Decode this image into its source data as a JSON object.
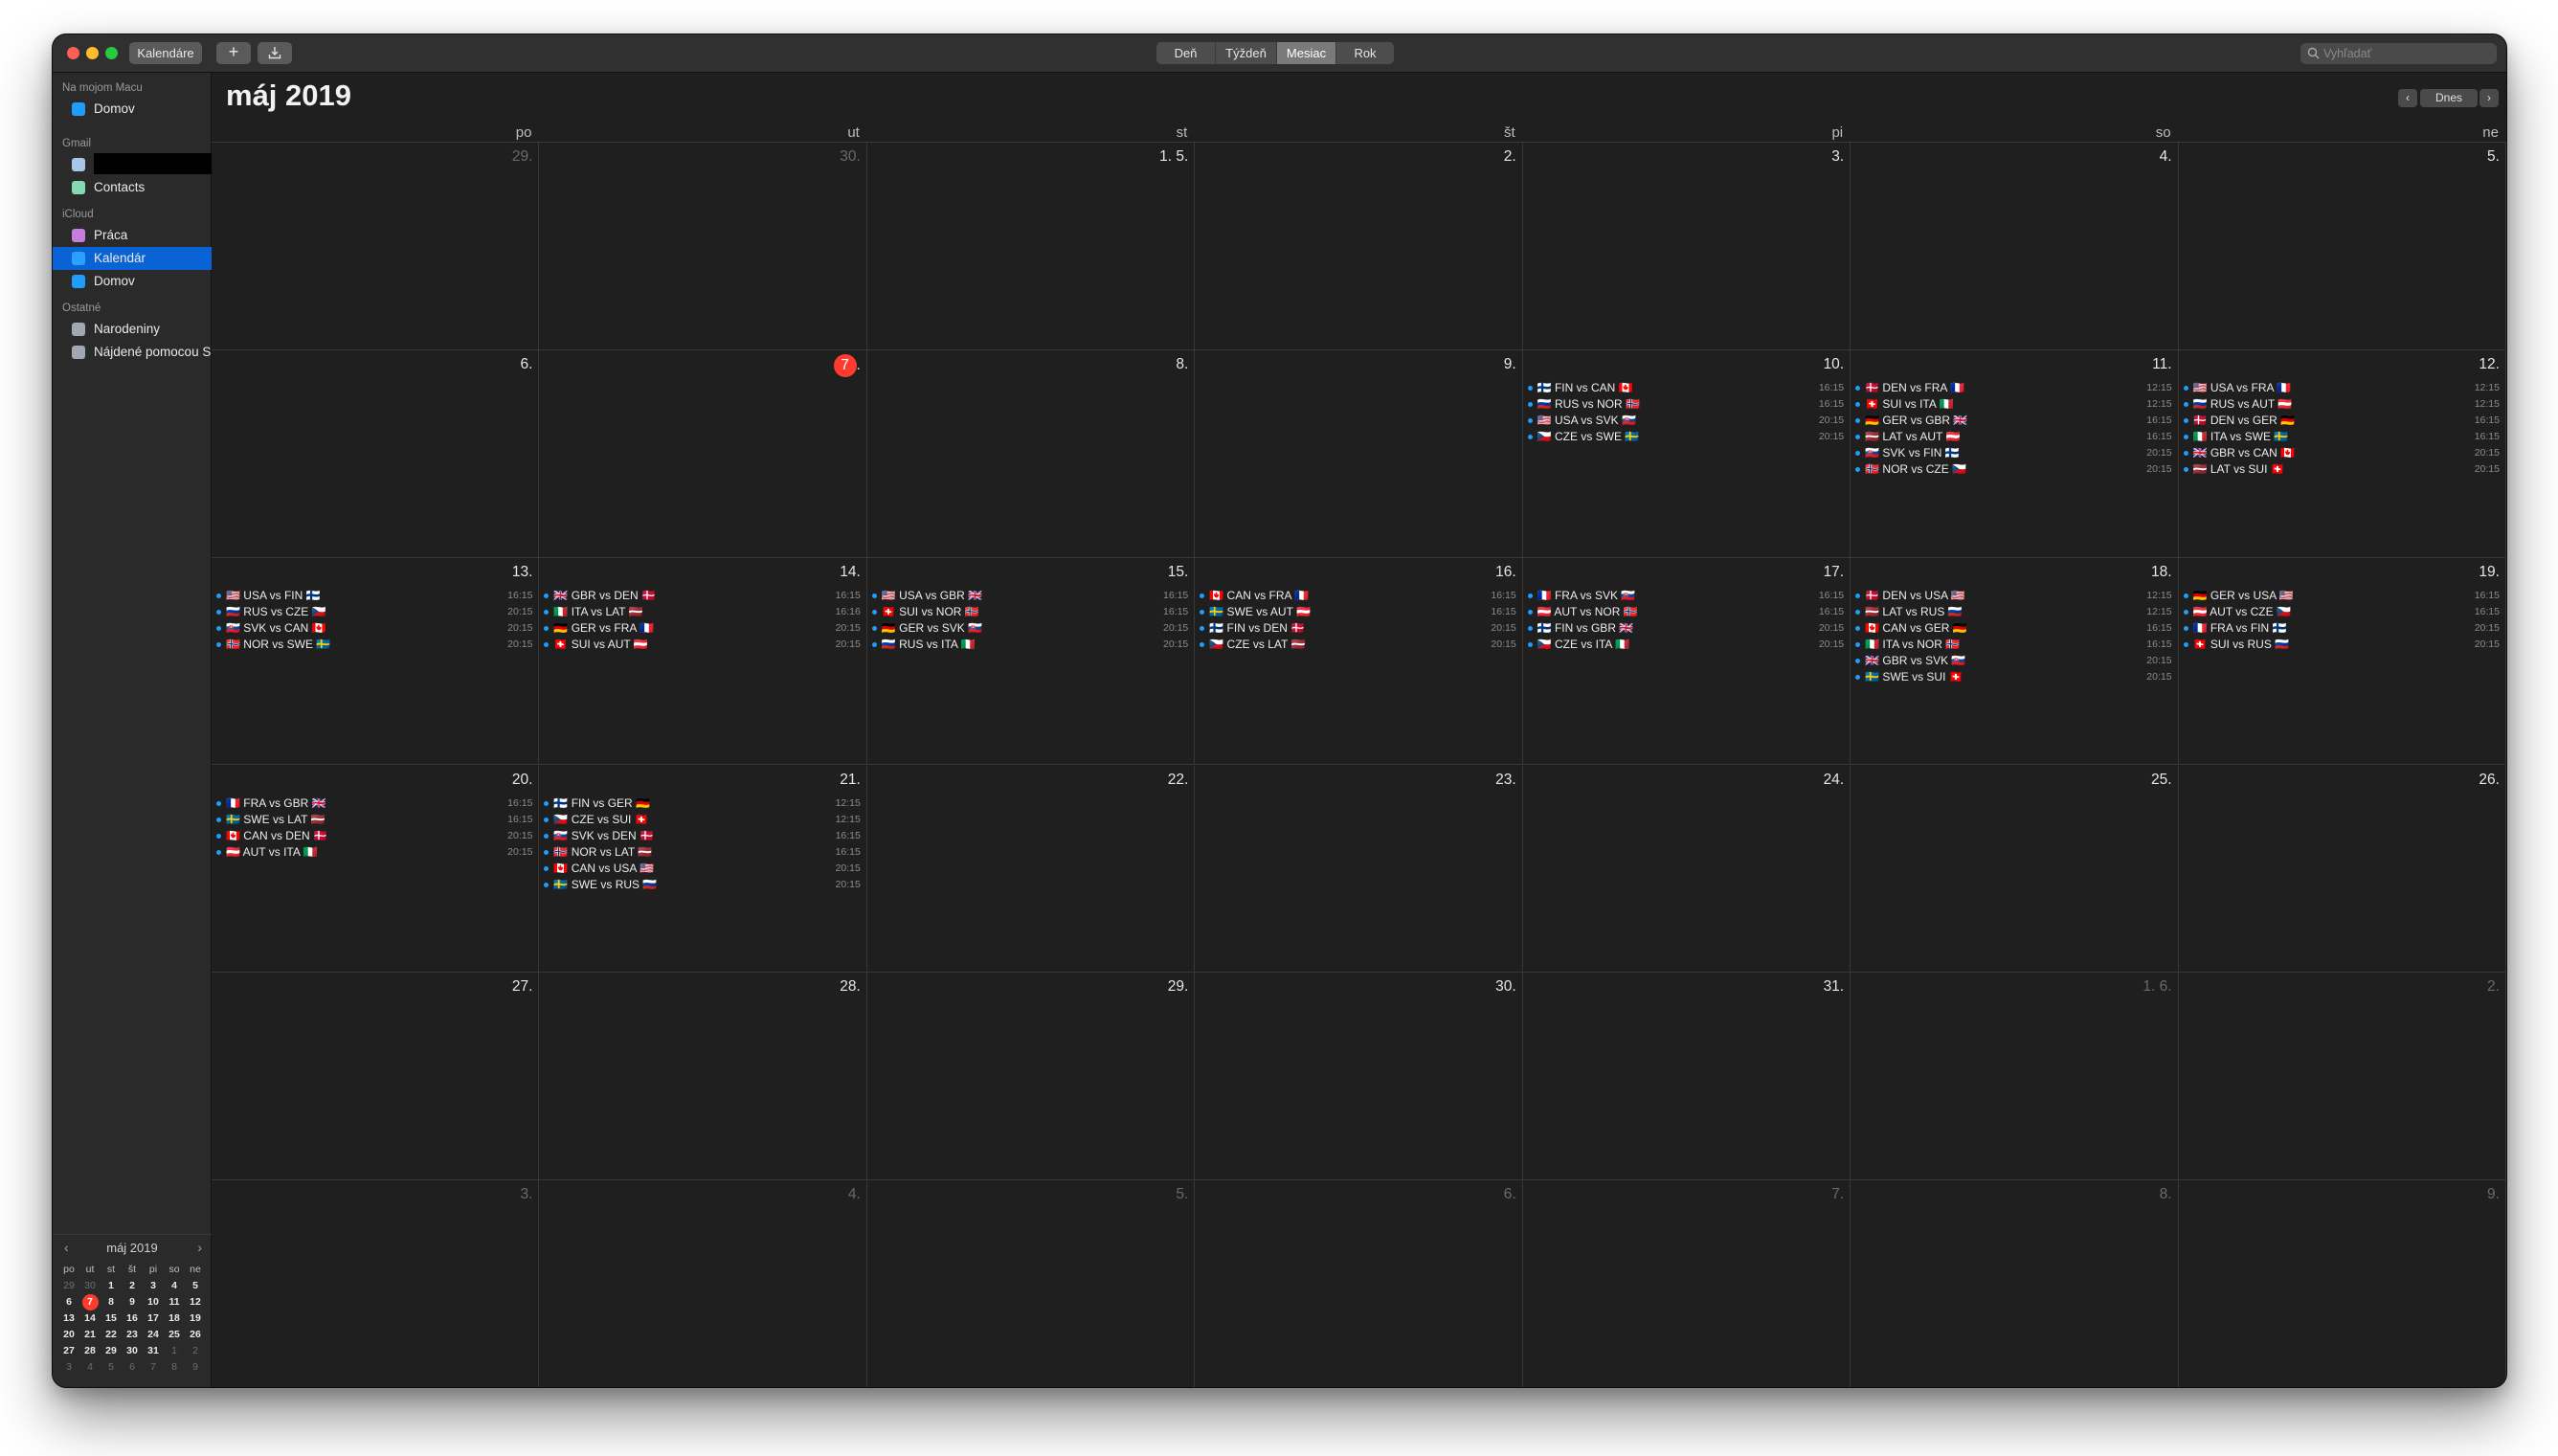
{
  "toolbar": {
    "calendars_label": "Kalendáre",
    "add_label": "+",
    "views": [
      "Deň",
      "Týždeň",
      "Mesiac",
      "Rok"
    ],
    "active_view": "Mesiac",
    "search_placeholder": "Vyhľadať"
  },
  "sidebar": {
    "groups": [
      {
        "label": "Na mojom Macu",
        "items": [
          {
            "name": "Domov",
            "color": "#1e9dfc"
          }
        ]
      },
      {
        "label": "Gmail",
        "items": [
          {
            "name": "",
            "color": "#a7c7e7",
            "redacted": true
          },
          {
            "name": "Contacts",
            "color": "#84d9b1"
          }
        ]
      },
      {
        "label": "iCloud",
        "items": [
          {
            "name": "Práca",
            "color": "#c77dde"
          },
          {
            "name": "Kalendár",
            "color": "#2aa1ff",
            "selected": true
          },
          {
            "name": "Domov",
            "color": "#1e9dfc"
          }
        ]
      },
      {
        "label": "Ostatné",
        "items": [
          {
            "name": "Narodeniny",
            "color": "#a2a8b2"
          },
          {
            "name": "Nájdené pomocou Siri",
            "color": "#a2a8b2"
          }
        ]
      }
    ]
  },
  "mini_calendar": {
    "title": "máj 2019",
    "headers": [
      "po",
      "ut",
      "st",
      "št",
      "pi",
      "so",
      "ne"
    ],
    "weeks": [
      [
        "29",
        "30",
        "1",
        "2",
        "3",
        "4",
        "5"
      ],
      [
        "6",
        "7",
        "8",
        "9",
        "10",
        "11",
        "12"
      ],
      [
        "13",
        "14",
        "15",
        "16",
        "17",
        "18",
        "19"
      ],
      [
        "20",
        "21",
        "22",
        "23",
        "24",
        "25",
        "26"
      ],
      [
        "27",
        "28",
        "29",
        "30",
        "31",
        "1",
        "2"
      ],
      [
        "3",
        "4",
        "5",
        "6",
        "7",
        "8",
        "9"
      ]
    ]
  },
  "main": {
    "month_title": "máj 2019",
    "today_label": "Dnes",
    "weekdays": [
      "po",
      "ut",
      "st",
      "št",
      "pi",
      "so",
      "ne"
    ],
    "weeks": [
      [
        {
          "label": "29.",
          "dim": true,
          "events": []
        },
        {
          "label": "30.",
          "dim": true,
          "events": []
        },
        {
          "label": "1. 5.",
          "events": []
        },
        {
          "label": "2.",
          "events": []
        },
        {
          "label": "3.",
          "events": []
        },
        {
          "label": "4.",
          "events": []
        },
        {
          "label": "5.",
          "events": []
        }
      ],
      [
        {
          "label": "6.",
          "events": []
        },
        {
          "label": "7",
          "suffix": ".",
          "today": true,
          "events": []
        },
        {
          "label": "8.",
          "events": []
        },
        {
          "label": "9.",
          "events": []
        },
        {
          "label": "10.",
          "events": [
            {
              "title": "🇫🇮 FIN vs CAN 🇨🇦",
              "time": "16:15"
            },
            {
              "title": "🇷🇺 RUS vs NOR 🇳🇴",
              "time": "16:15"
            },
            {
              "title": "🇺🇸 USA vs SVK 🇸🇰",
              "time": "20:15"
            },
            {
              "title": "🇨🇿 CZE vs SWE 🇸🇪",
              "time": "20:15"
            }
          ]
        },
        {
          "label": "11.",
          "events": [
            {
              "title": "🇩🇰 DEN vs FRA 🇫🇷",
              "time": "12:15"
            },
            {
              "title": "🇨🇭 SUI vs ITA 🇮🇹",
              "time": "12:15"
            },
            {
              "title": "🇩🇪 GER vs GBR 🇬🇧",
              "time": "16:15"
            },
            {
              "title": "🇱🇻 LAT vs AUT 🇦🇹",
              "time": "16:15"
            },
            {
              "title": "🇸🇰 SVK vs FIN 🇫🇮",
              "time": "20:15"
            },
            {
              "title": "🇳🇴 NOR vs CZE 🇨🇿",
              "time": "20:15"
            }
          ]
        },
        {
          "label": "12.",
          "events": [
            {
              "title": "🇺🇸 USA vs FRA 🇫🇷",
              "time": "12:15"
            },
            {
              "title": "🇷🇺 RUS vs AUT 🇦🇹",
              "time": "12:15"
            },
            {
              "title": "🇩🇰 DEN vs GER 🇩🇪",
              "time": "16:15"
            },
            {
              "title": "🇮🇹 ITA vs SWE 🇸🇪",
              "time": "16:15"
            },
            {
              "title": "🇬🇧 GBR vs CAN 🇨🇦",
              "time": "20:15"
            },
            {
              "title": "🇱🇻 LAT vs SUI 🇨🇭",
              "time": "20:15"
            }
          ]
        }
      ],
      [
        {
          "label": "13.",
          "events": [
            {
              "title": "🇺🇸 USA vs FIN 🇫🇮",
              "time": "16:15"
            },
            {
              "title": "🇷🇺 RUS vs CZE 🇨🇿",
              "time": "20:15"
            },
            {
              "title": "🇸🇰 SVK vs CAN 🇨🇦",
              "time": "20:15"
            },
            {
              "title": "🇳🇴 NOR vs SWE 🇸🇪",
              "time": "20:15"
            }
          ]
        },
        {
          "label": "14.",
          "events": [
            {
              "title": "🇬🇧 GBR vs DEN 🇩🇰",
              "time": "16:15"
            },
            {
              "title": "🇮🇹 ITA vs LAT 🇱🇻",
              "time": "16:16"
            },
            {
              "title": "🇩🇪 GER vs FRA 🇫🇷",
              "time": "20:15"
            },
            {
              "title": "🇨🇭 SUI vs AUT 🇦🇹",
              "time": "20:15"
            }
          ]
        },
        {
          "label": "15.",
          "events": [
            {
              "title": "🇺🇸 USA vs GBR 🇬🇧",
              "time": "16:15"
            },
            {
              "title": "🇨🇭 SUI vs NOR 🇳🇴",
              "time": "16:15"
            },
            {
              "title": "🇩🇪 GER vs SVK 🇸🇰",
              "time": "20:15"
            },
            {
              "title": "🇷🇺 RUS vs ITA 🇮🇹",
              "time": "20:15"
            }
          ]
        },
        {
          "label": "16.",
          "events": [
            {
              "title": "🇨🇦 CAN vs FRA 🇫🇷",
              "time": "16:15"
            },
            {
              "title": "🇸🇪 SWE vs AUT 🇦🇹",
              "time": "16:15"
            },
            {
              "title": "🇫🇮 FIN vs DEN 🇩🇰",
              "time": "20:15"
            },
            {
              "title": "🇨🇿 CZE vs LAT 🇱🇻",
              "time": "20:15"
            }
          ]
        },
        {
          "label": "17.",
          "events": [
            {
              "title": "🇫🇷 FRA vs SVK 🇸🇰",
              "time": "16:15"
            },
            {
              "title": "🇦🇹 AUT vs NOR 🇳🇴",
              "time": "16:15"
            },
            {
              "title": "🇫🇮 FIN vs GBR 🇬🇧",
              "time": "20:15"
            },
            {
              "title": "🇨🇿 CZE vs ITA 🇮🇹",
              "time": "20:15"
            }
          ]
        },
        {
          "label": "18.",
          "events": [
            {
              "title": "🇩🇰 DEN vs USA 🇺🇸",
              "time": "12:15"
            },
            {
              "title": "🇱🇻 LAT vs RUS 🇷🇺",
              "time": "12:15"
            },
            {
              "title": "🇨🇦 CAN vs GER 🇩🇪",
              "time": "16:15"
            },
            {
              "title": "🇮🇹 ITA vs NOR 🇳🇴",
              "time": "16:15"
            },
            {
              "title": "🇬🇧 GBR vs SVK 🇸🇰",
              "time": "20:15"
            },
            {
              "title": "🇸🇪 SWE vs SUI 🇨🇭",
              "time": "20:15"
            }
          ]
        },
        {
          "label": "19.",
          "events": [
            {
              "title": "🇩🇪 GER vs USA 🇺🇸",
              "time": "16:15"
            },
            {
              "title": "🇦🇹 AUT vs CZE 🇨🇿",
              "time": "16:15"
            },
            {
              "title": "🇫🇷 FRA vs FIN 🇫🇮",
              "time": "20:15"
            },
            {
              "title": "🇨🇭 SUI vs RUS 🇷🇺",
              "time": "20:15"
            }
          ]
        }
      ],
      [
        {
          "label": "20.",
          "events": [
            {
              "title": "🇫🇷 FRA vs GBR 🇬🇧",
              "time": "16:15"
            },
            {
              "title": "🇸🇪 SWE vs LAT 🇱🇻",
              "time": "16:15"
            },
            {
              "title": "🇨🇦 CAN vs DEN 🇩🇰",
              "time": "20:15"
            },
            {
              "title": "🇦🇹 AUT vs ITA 🇮🇹",
              "time": "20:15"
            }
          ]
        },
        {
          "label": "21.",
          "events": [
            {
              "title": "🇫🇮 FIN vs GER 🇩🇪",
              "time": "12:15"
            },
            {
              "title": "🇨🇿 CZE vs SUI 🇨🇭",
              "time": "12:15"
            },
            {
              "title": "🇸🇰 SVK vs DEN 🇩🇰",
              "time": "16:15"
            },
            {
              "title": "🇳🇴 NOR vs LAT 🇱🇻",
              "time": "16:15"
            },
            {
              "title": "🇨🇦 CAN vs USA 🇺🇸",
              "time": "20:15"
            },
            {
              "title": "🇸🇪 SWE vs RUS 🇷🇺",
              "time": "20:15"
            }
          ]
        },
        {
          "label": "22.",
          "events": []
        },
        {
          "label": "23.",
          "events": []
        },
        {
          "label": "24.",
          "events": []
        },
        {
          "label": "25.",
          "events": []
        },
        {
          "label": "26.",
          "events": []
        }
      ],
      [
        {
          "label": "27.",
          "events": []
        },
        {
          "label": "28.",
          "events": []
        },
        {
          "label": "29.",
          "events": []
        },
        {
          "label": "30.",
          "events": []
        },
        {
          "label": "31.",
          "events": []
        },
        {
          "label": "1. 6.",
          "dim": true,
          "events": []
        },
        {
          "label": "2.",
          "dim": true,
          "events": []
        }
      ],
      [
        {
          "label": "3.",
          "dim": true,
          "events": []
        },
        {
          "label": "4.",
          "dim": true,
          "events": []
        },
        {
          "label": "5.",
          "dim": true,
          "events": []
        },
        {
          "label": "6.",
          "dim": true,
          "events": []
        },
        {
          "label": "7.",
          "dim": true,
          "events": []
        },
        {
          "label": "8.",
          "dim": true,
          "events": []
        },
        {
          "label": "9.",
          "dim": true,
          "events": []
        }
      ]
    ]
  }
}
